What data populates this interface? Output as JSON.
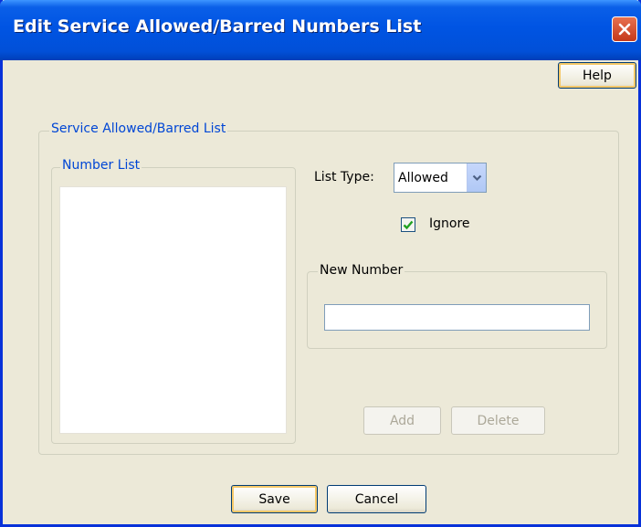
{
  "window": {
    "title": "Edit Service Allowed/Barred Numbers List"
  },
  "toolbar": {
    "help_label": "Help"
  },
  "service_group": {
    "label": "Service Allowed/Barred List",
    "number_list": {
      "label": "Number List",
      "items": []
    },
    "list_type": {
      "label": "List Type:",
      "selected": "Allowed"
    },
    "ignore": {
      "label": "Ignore",
      "checked": true
    },
    "new_number": {
      "label": "New Number",
      "value": ""
    },
    "add_label": "Add",
    "delete_label": "Delete"
  },
  "footer": {
    "save_label": "Save",
    "cancel_label": "Cancel"
  },
  "colors": {
    "titlebar": "#0054e3",
    "window_bg": "#ece9d8",
    "group_label": "#0046d5",
    "close_button": "#c4381a",
    "checkmark": "#21a121"
  }
}
